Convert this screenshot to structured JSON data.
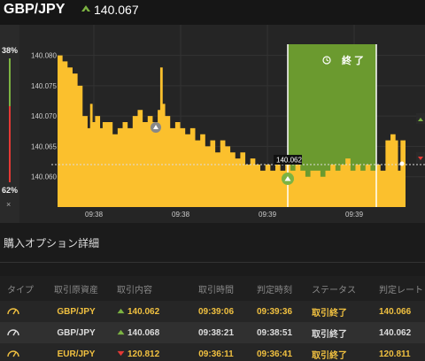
{
  "header": {
    "pair": "GBP/JPY",
    "price": "140.067",
    "direction_icon": "up-arrow-icon",
    "up_color": "#7cb342"
  },
  "sidebar": {
    "top_pct": "38%",
    "bottom_pct": "62%",
    "close_glyph": "×"
  },
  "chart_data": {
    "type": "area",
    "y_ticks": [
      "140.080",
      "140.075",
      "140.070",
      "140.065",
      "140.060"
    ],
    "x_ticks": [
      "09:38",
      "09:38",
      "09:39",
      "09:39"
    ],
    "ylim": [
      140.055,
      140.083
    ],
    "current_price_label": "140.062",
    "expiry_label": "終 了",
    "clock_icon": "clock-icon",
    "area_color": "#fbc02d",
    "expiry_zone_color": "#6b9a2f",
    "points": [
      [
        0,
        140.08
      ],
      [
        2,
        140.079
      ],
      [
        4,
        140.078
      ],
      [
        6,
        140.077
      ],
      [
        8,
        140.075
      ],
      [
        10,
        140.07
      ],
      [
        12,
        140.068
      ],
      [
        13,
        140.072
      ],
      [
        14,
        140.069
      ],
      [
        15,
        140.07
      ],
      [
        17,
        140.068
      ],
      [
        18,
        140.069
      ],
      [
        20,
        140.069
      ],
      [
        22,
        140.067
      ],
      [
        24,
        140.068
      ],
      [
        26,
        140.069
      ],
      [
        28,
        140.068
      ],
      [
        30,
        140.07
      ],
      [
        32,
        140.071
      ],
      [
        34,
        140.069
      ],
      [
        36,
        140.07
      ],
      [
        38,
        140.069
      ],
      [
        40,
        140.071
      ],
      [
        41,
        140.078
      ],
      [
        42,
        140.072
      ],
      [
        43,
        140.07
      ],
      [
        45,
        140.068
      ],
      [
        47,
        140.069
      ],
      [
        49,
        140.068
      ],
      [
        51,
        140.067
      ],
      [
        53,
        140.068
      ],
      [
        55,
        140.066
      ],
      [
        57,
        140.067
      ],
      [
        59,
        140.065
      ],
      [
        61,
        140.066
      ],
      [
        63,
        140.064
      ],
      [
        65,
        140.066
      ],
      [
        67,
        140.065
      ],
      [
        69,
        140.064
      ],
      [
        71,
        140.063
      ],
      [
        73,
        140.064
      ],
      [
        75,
        140.062
      ],
      [
        77,
        140.063
      ],
      [
        79,
        140.062
      ],
      [
        81,
        140.061
      ],
      [
        83,
        140.062
      ],
      [
        85,
        140.061
      ],
      [
        87,
        140.062
      ],
      [
        89,
        140.061
      ],
      [
        91,
        140.062
      ],
      [
        93,
        140.061
      ],
      [
        95,
        140.062
      ],
      [
        97,
        140.061
      ],
      [
        99,
        140.06
      ],
      [
        101,
        140.061
      ],
      [
        103,
        140.061
      ],
      [
        105,
        140.06
      ],
      [
        107,
        140.061
      ],
      [
        109,
        140.062
      ],
      [
        111,
        140.061
      ],
      [
        113,
        140.062
      ],
      [
        115,
        140.063
      ],
      [
        117,
        140.061
      ],
      [
        119,
        140.062
      ],
      [
        121,
        140.061
      ],
      [
        123,
        140.062
      ],
      [
        125,
        140.061
      ],
      [
        127,
        140.062
      ],
      [
        129,
        140.061
      ],
      [
        131,
        140.066
      ],
      [
        133,
        140.067
      ],
      [
        135,
        140.066
      ],
      [
        136,
        140.061
      ],
      [
        137,
        140.066
      ],
      [
        139,
        140.066
      ]
    ]
  },
  "section": {
    "title": "購入オプション詳細"
  },
  "table": {
    "headers": [
      "タイプ",
      "取引原資産",
      "取引内容",
      "取引時間",
      "判定時刻",
      "ステータス",
      "判定レート"
    ],
    "rows": [
      {
        "type_icon": "gauge-icon",
        "asset": "GBP/JPY",
        "dir": "up",
        "content": "140.062",
        "time": "09:39:06",
        "expiry": "09:39:36",
        "status": "取引終了",
        "rate": "140.066"
      },
      {
        "type_icon": "gauge-icon",
        "asset": "GBP/JPY",
        "dir": "up",
        "content": "140.068",
        "time": "09:38:21",
        "expiry": "09:38:51",
        "status": "取引終了",
        "rate": "140.062"
      },
      {
        "type_icon": "gauge-icon",
        "asset": "EUR/JPY",
        "dir": "down",
        "content": "120.812",
        "time": "09:36:11",
        "expiry": "09:36:41",
        "status": "取引終了",
        "rate": "120.811"
      }
    ],
    "up_color": "#7cb342",
    "down_color": "#e53935"
  }
}
